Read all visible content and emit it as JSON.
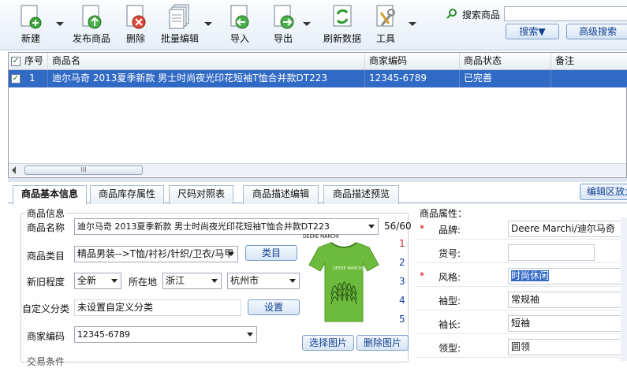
{
  "toolbar": {
    "new": "新建",
    "publish": "发布商品",
    "delete": "删除",
    "batch_edit": "批量编辑",
    "import": "导入",
    "export": "导出",
    "refresh": "刷新数据",
    "tools": "工具"
  },
  "search": {
    "label": "搜索商品",
    "input_value": "",
    "search_button": "搜索▼",
    "advanced_button": "高级搜索"
  },
  "grid": {
    "headers": [
      "序号",
      "商品名",
      "商家编码",
      "商品状态",
      "备注"
    ],
    "rows": [
      {
        "index": "1",
        "name": "迪尔马奇 2013夏季新款 男士时尚夜光印花短袖T恤合并款DT223",
        "code": "12345-6789",
        "status": "已完善",
        "note": ""
      }
    ],
    "scroll_thumb": "III"
  },
  "tabs": [
    "商品基本信息",
    "商品库存属性",
    "尺码对照表",
    "商品描述编辑",
    "商品描述预览"
  ],
  "edit_area_button": "编辑区放大",
  "info": {
    "section_title": "商品信息",
    "name_label": "商品名称",
    "name_value": "迪尔马奇 2013夏季新款 男士时尚夜光印花短袖T恤合并款DT223",
    "name_count": "56/60",
    "category_label": "商品类目",
    "category_value": "精品男装-->T恤/衬衫/针织/卫衣/马甲",
    "category_button": "类目",
    "condition_label": "新旧程度",
    "condition_value": "全新",
    "location_label": "所在地",
    "province_value": "浙江",
    "city_value": "杭州市",
    "custom_cat_label": "自定义分类",
    "custom_cat_value": "未设置自定义分类",
    "settings_button": "设置",
    "merchant_code_label": "商家编码",
    "merchant_code_value": "12345-6789",
    "select_image_button": "选择图片",
    "delete_image_button": "删除图片",
    "image_numbers": [
      "1",
      "2",
      "3",
      "4",
      "5"
    ],
    "brand_logo_text": "DEERE MARCHI",
    "shirt_print_text": "DEERE MARCHI",
    "partial_label": "交易条件"
  },
  "attributes": {
    "title": "商品属性：",
    "rows": [
      {
        "required": "*",
        "label": "品牌:",
        "value": "Deere Marchi/迪尔马奇"
      },
      {
        "required": "",
        "label": "货号:",
        "value": ""
      },
      {
        "required": "*",
        "label": "风格:",
        "value": "时尚休闲"
      },
      {
        "required": "",
        "label": "袖型:",
        "value": "常规袖"
      },
      {
        "required": "",
        "label": "袖长:",
        "value": "短袖"
      },
      {
        "required": "",
        "label": "领型:",
        "value": "圆领"
      }
    ]
  },
  "colors": {
    "selection": "#316ac5",
    "button_text": "#103f91",
    "required_star": "#dd0000"
  }
}
